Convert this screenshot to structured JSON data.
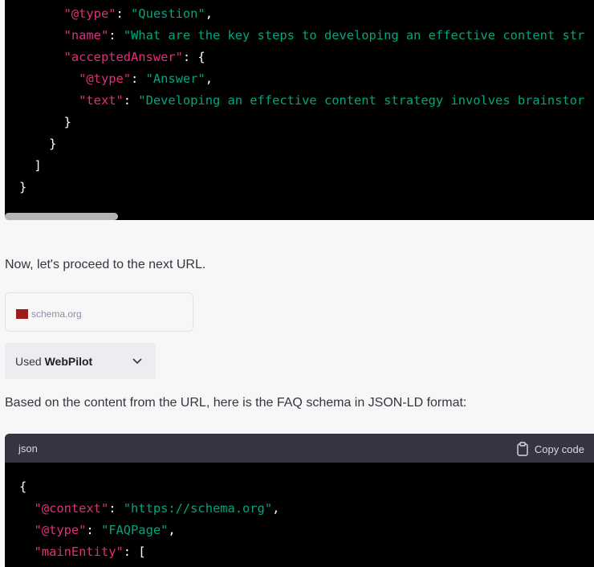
{
  "code_block_1": {
    "lines": [
      {
        "indent": "      ",
        "key": "\"@type\"",
        "sep": ": ",
        "val": "\"Question\"",
        "end": ","
      },
      {
        "indent": "      ",
        "key": "\"name\"",
        "sep": ": ",
        "val": "\"What are the key steps to developing an effective content str",
        "end": ""
      },
      {
        "indent": "      ",
        "key": "\"acceptedAnswer\"",
        "sep": ": {",
        "val": "",
        "end": ""
      },
      {
        "indent": "        ",
        "key": "\"@type\"",
        "sep": ": ",
        "val": "\"Answer\"",
        "end": ","
      },
      {
        "indent": "        ",
        "key": "\"text\"",
        "sep": ": ",
        "val": "\"Developing an effective content strategy involves brainstor",
        "end": ""
      },
      {
        "indent": "      ",
        "key": "",
        "sep": "}",
        "val": "",
        "end": ""
      },
      {
        "indent": "    ",
        "key": "",
        "sep": "}",
        "val": "",
        "end": ""
      },
      {
        "indent": "  ",
        "key": "",
        "sep": "]",
        "val": "",
        "end": ""
      },
      {
        "indent": "",
        "key": "",
        "sep": "}",
        "val": "",
        "end": ""
      }
    ]
  },
  "message": {
    "text1": "Now, let's proceed to the next URL.",
    "source": "schema.org",
    "used_prefix": "Used ",
    "used_plugin": "WebPilot",
    "text2": "Based on the content from the URL, here is the FAQ schema in JSON-LD format:"
  },
  "code_block_2": {
    "language": "json",
    "copy_label": "Copy code",
    "lines": [
      {
        "indent": "",
        "key": "",
        "sep": "{",
        "val": "",
        "end": ""
      },
      {
        "indent": "  ",
        "key": "\"@context\"",
        "sep": ": ",
        "val": "\"https://schema.org\"",
        "end": ","
      },
      {
        "indent": "  ",
        "key": "\"@type\"",
        "sep": ": ",
        "val": "\"FAQPage\"",
        "end": ","
      },
      {
        "indent": "  ",
        "key": "\"mainEntity\"",
        "sep": ": [",
        "val": "",
        "end": ""
      }
    ]
  },
  "colors": {
    "key": "#df3079",
    "string": "#00a67d"
  }
}
